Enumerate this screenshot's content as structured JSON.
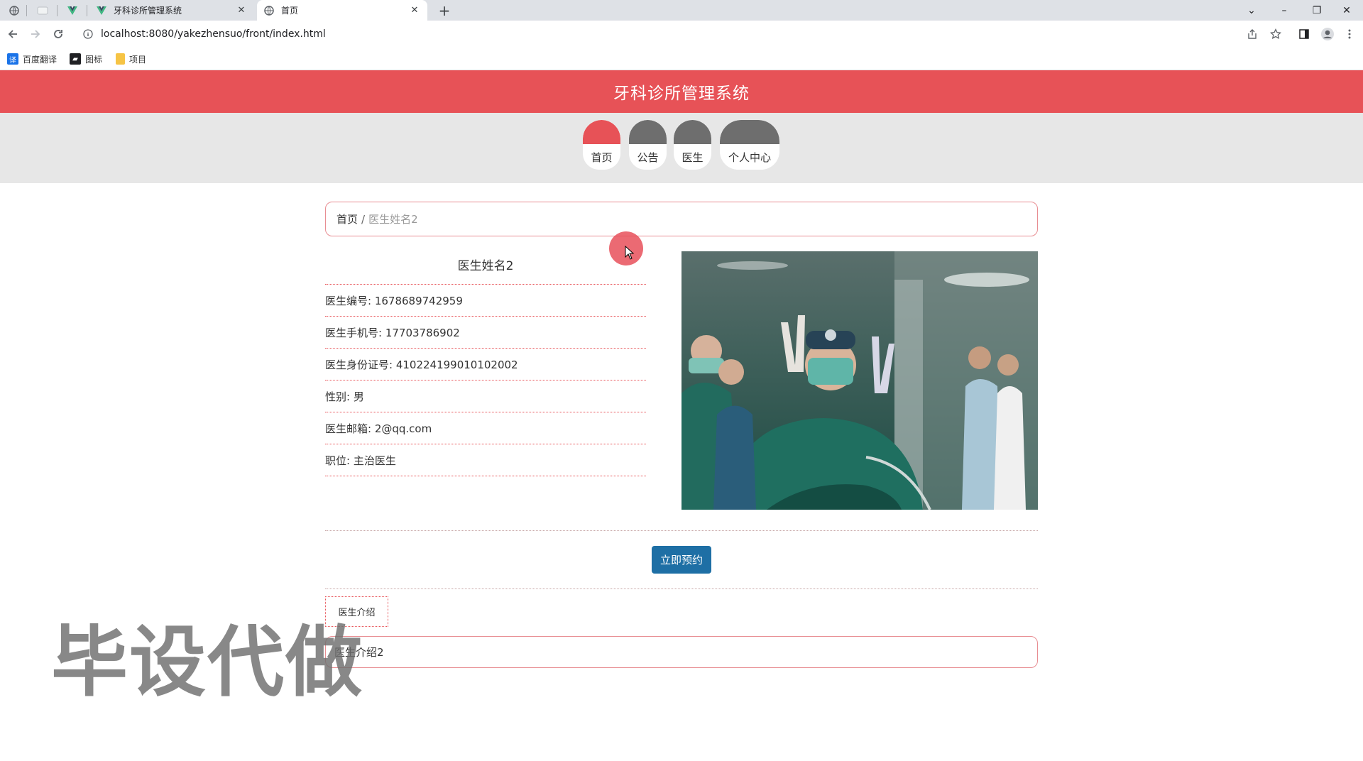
{
  "browser": {
    "tabs": [
      {
        "title": "牙科诊所管理系统"
      },
      {
        "title": "首页"
      }
    ],
    "new_tab": "+",
    "address": "localhost:8080/yakezhensuo/front/index.html",
    "bookmarks": [
      {
        "label": "百度翻译",
        "icon": "translate-icon",
        "color": "#1a73e8"
      },
      {
        "label": "图标",
        "icon": "flag-icon",
        "color": "#202124"
      },
      {
        "label": "项目",
        "icon": "folder-icon",
        "color": "#f6c445"
      }
    ],
    "window_controls": {
      "minimize": "–",
      "restore": "❐",
      "close": "✕",
      "tab_list": "⌄"
    }
  },
  "site": {
    "title": "牙科诊所管理系统",
    "accent_color": "#e75257",
    "nav": [
      {
        "label": "首页",
        "active": true
      },
      {
        "label": "公告",
        "active": false
      },
      {
        "label": "医生",
        "active": false
      },
      {
        "label": "个人中心",
        "active": false
      }
    ]
  },
  "breadcrumb": {
    "home": "首页",
    "separator": "/",
    "current": "医生姓名2"
  },
  "doctor": {
    "name": "医生姓名2",
    "fields": [
      {
        "label": "医生编号",
        "value": "1678689742959"
      },
      {
        "label": "医生手机号",
        "value": "17703786902"
      },
      {
        "label": "医生身份证号",
        "value": "410224199010102002"
      },
      {
        "label": "性别",
        "value": "男"
      },
      {
        "label": "医生邮箱",
        "value": "2@qq.com"
      },
      {
        "label": "职位",
        "value": "主治医生"
      }
    ],
    "field_lines": [
      "医生编号: 1678689742959",
      "医生手机号: 17703786902",
      "医生身份证号: 410224199010102002",
      "性别: 男",
      "医生邮箱: 2@qq.com",
      "职位: 主治医生"
    ]
  },
  "actions": {
    "book_label": "立即预约",
    "book_color": "#1e6fa5"
  },
  "intro": {
    "tab_label": "医生介绍",
    "content": "医生介绍2"
  },
  "watermark": "毕设代做"
}
